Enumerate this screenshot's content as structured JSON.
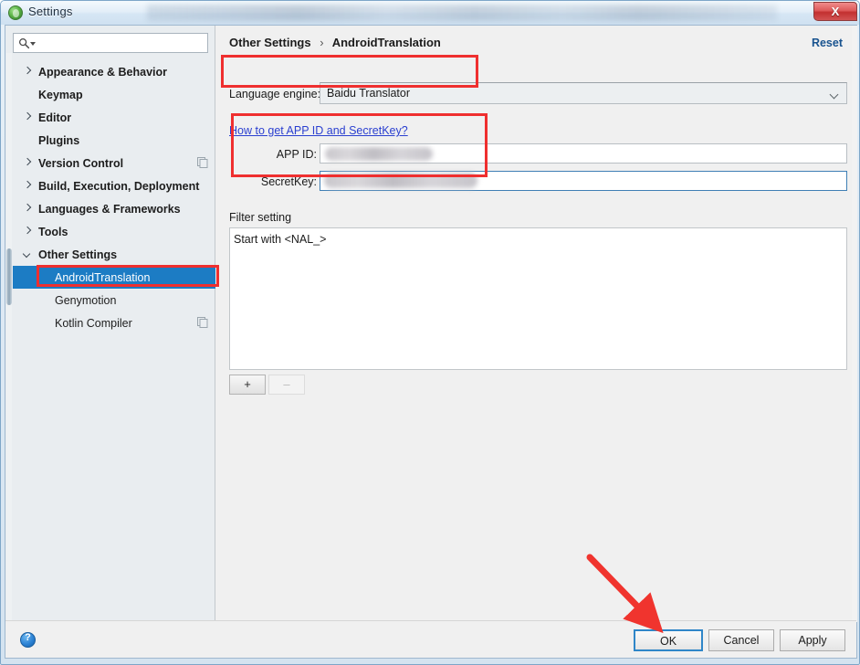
{
  "window": {
    "title": "Settings",
    "app_icon": "intellij-icon",
    "close_label": "X"
  },
  "search": {
    "placeholder": "",
    "value": "",
    "icon": "search-icon"
  },
  "sidebar": {
    "items": [
      {
        "label": "Appearance & Behavior",
        "level": "top",
        "arrow": "right",
        "selected": false,
        "scope_icon": false
      },
      {
        "label": "Keymap",
        "level": "top-noarrow",
        "arrow": "none",
        "selected": false,
        "scope_icon": false
      },
      {
        "label": "Editor",
        "level": "top",
        "arrow": "right",
        "selected": false,
        "scope_icon": false
      },
      {
        "label": "Plugins",
        "level": "top-noarrow",
        "arrow": "none",
        "selected": false,
        "scope_icon": false
      },
      {
        "label": "Version Control",
        "level": "top",
        "arrow": "right",
        "selected": false,
        "scope_icon": true
      },
      {
        "label": "Build, Execution, Deployment",
        "level": "top",
        "arrow": "right",
        "selected": false,
        "scope_icon": false
      },
      {
        "label": "Languages & Frameworks",
        "level": "top",
        "arrow": "right",
        "selected": false,
        "scope_icon": false
      },
      {
        "label": "Tools",
        "level": "top",
        "arrow": "right",
        "selected": false,
        "scope_icon": false
      },
      {
        "label": "Other Settings",
        "level": "top",
        "arrow": "down",
        "selected": false,
        "scope_icon": false
      },
      {
        "label": "AndroidTranslation",
        "level": "leaf",
        "arrow": "none",
        "selected": true,
        "scope_icon": false
      },
      {
        "label": "Genymotion",
        "level": "leaf",
        "arrow": "none",
        "selected": false,
        "scope_icon": false
      },
      {
        "label": "Kotlin Compiler",
        "level": "leaf",
        "arrow": "none",
        "selected": false,
        "scope_icon": true
      }
    ]
  },
  "content": {
    "breadcrumb": {
      "parent": "Other Settings",
      "separator": "›",
      "current": "AndroidTranslation"
    },
    "reset_label": "Reset",
    "language_engine": {
      "label": "Language engine:",
      "value": "Baidu Translator",
      "chevron_icon": "chevron-down-icon"
    },
    "howto_link": "How to get APP ID and SecretKey?",
    "credentials": {
      "appid_label": "APP ID:",
      "appid_value": "",
      "secretkey_label": "SecretKey:",
      "secretkey_value": ""
    },
    "filter": {
      "label": "Filter setting",
      "items": [
        "Start with <NAL_>"
      ],
      "add_label": "+",
      "remove_label": "–"
    }
  },
  "footer": {
    "help_icon": "help-icon",
    "help_glyph": "?",
    "ok_label": "OK",
    "cancel_label": "Cancel",
    "apply_label": "Apply"
  },
  "annotations": {
    "accent_color": "#ef2f2f",
    "highlight_boxes": [
      "language-engine-field",
      "app-credentials-fields",
      "sidebar-selected-item"
    ],
    "arrow_target": "OK"
  },
  "colors": {
    "selection_blue": "#1c7cc4",
    "link_blue": "#2a3fd0",
    "reset_blue": "#19538f",
    "annotation_red": "#ef2f2f",
    "focus_border": "#3f7fb5"
  }
}
